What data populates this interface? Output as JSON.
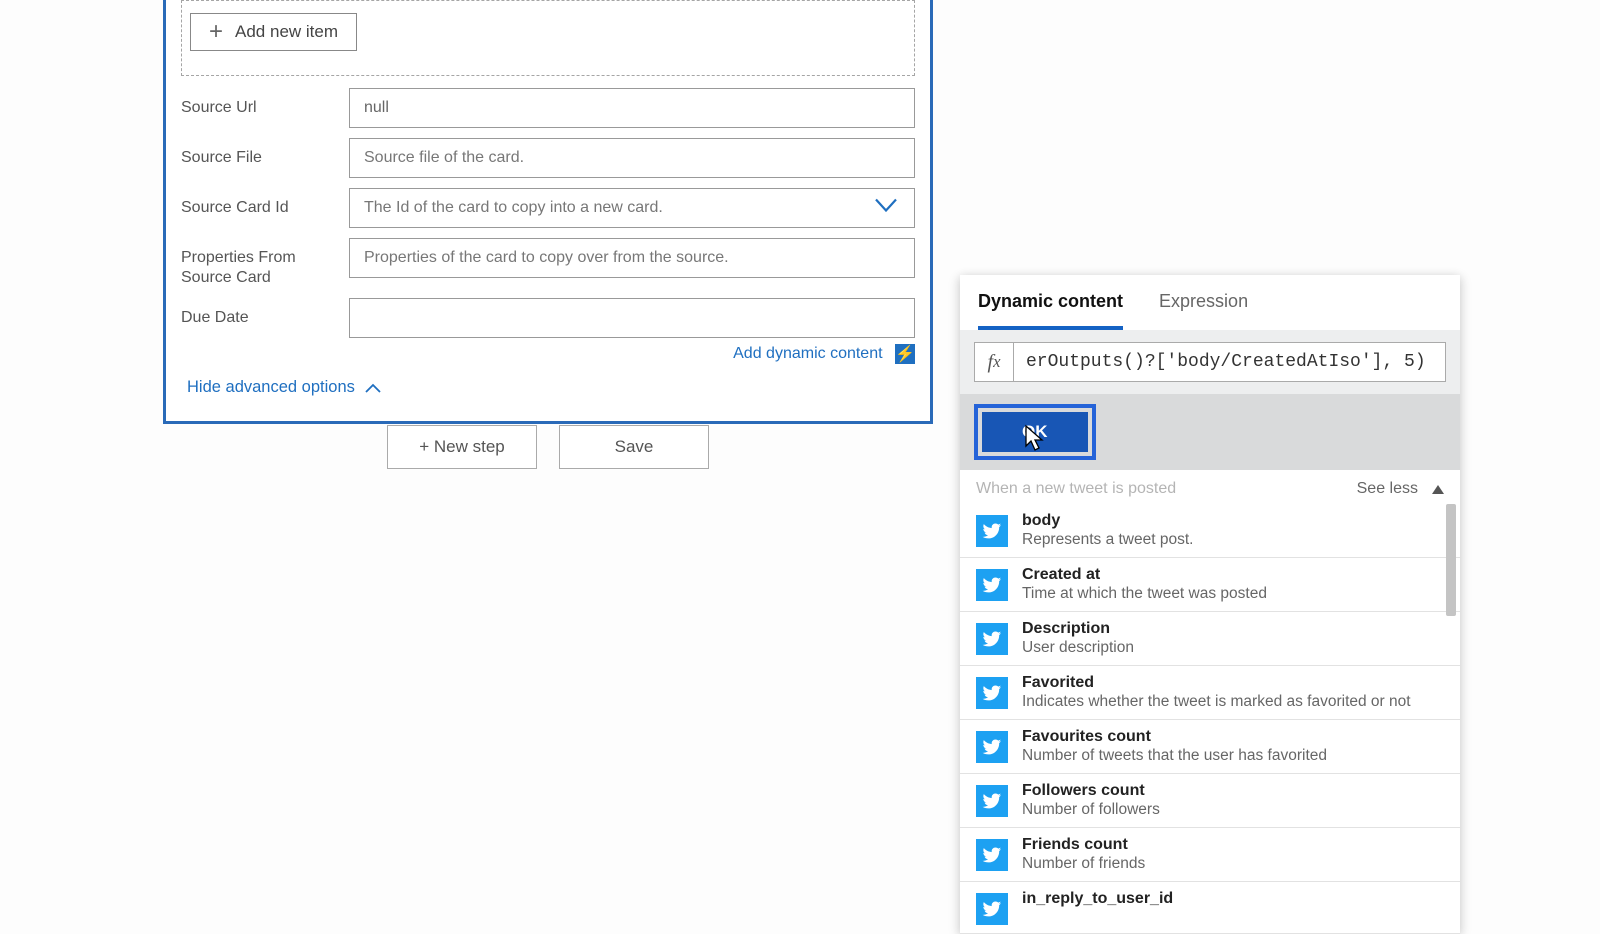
{
  "card": {
    "add_item_label": "Add new item",
    "fields": {
      "source_url": {
        "label": "Source Url",
        "value": "null"
      },
      "source_file": {
        "label": "Source File",
        "placeholder": "Source file of the card."
      },
      "source_card_id": {
        "label": "Source Card Id",
        "placeholder": "The Id of the card to copy into a new card."
      },
      "props_from_source": {
        "label": "Properties From Source Card",
        "placeholder": "Properties of the card to copy over from the source."
      },
      "due_date": {
        "label": "Due Date",
        "value": ""
      }
    },
    "add_dynamic_label": "Add dynamic content",
    "hide_advanced_label": "Hide advanced options"
  },
  "footer": {
    "new_step": "+ New step",
    "save": "Save"
  },
  "panel": {
    "tabs": {
      "dynamic": "Dynamic content",
      "expression": "Expression"
    },
    "fx_value": "erOutputs()?['body/CreatedAtIso'], 5)",
    "ok_label": "OK",
    "section_title": "When a new tweet is posted",
    "see_less": "See less",
    "items": [
      {
        "title": "body",
        "desc": "Represents a tweet post."
      },
      {
        "title": "Created at",
        "desc": "Time at which the tweet was posted"
      },
      {
        "title": "Description",
        "desc": "User description"
      },
      {
        "title": "Favorited",
        "desc": "Indicates whether the tweet is marked as favorited or not"
      },
      {
        "title": "Favourites count",
        "desc": "Number of tweets that the user has favorited"
      },
      {
        "title": "Followers count",
        "desc": "Number of followers"
      },
      {
        "title": "Friends count",
        "desc": "Number of friends"
      },
      {
        "title": "in_reply_to_user_id",
        "desc": ""
      }
    ]
  }
}
